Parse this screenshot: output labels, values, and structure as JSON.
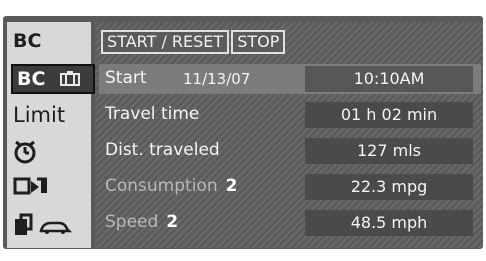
{
  "sidebar": {
    "title": "BC",
    "items": [
      {
        "label": "BC"
      },
      {
        "label": "Limit"
      }
    ],
    "icons": [
      "bc-display-icon",
      "stopwatch-icon",
      "arrow-box-icon",
      "door-car-icon"
    ]
  },
  "toolbar": {
    "start_reset_label": "START / RESET",
    "stop_label": "STOP"
  },
  "rows": [
    {
      "label": "Start",
      "date": "11/13/07",
      "value": "10:10AM"
    },
    {
      "label": "Travel time",
      "value": "01 h 02 min"
    },
    {
      "label": "Dist. traveled",
      "value": "127 mls"
    },
    {
      "label": "Consumption",
      "num": "2",
      "value": "22.3 mpg"
    },
    {
      "label": "Speed",
      "num": "2",
      "value": "48.5 mph"
    }
  ],
  "colors": {
    "screen_bg": "#5a5a5a",
    "sidebar_bg": "#d8d8d8",
    "selected_bg": "#3c3c3c",
    "text_light": "#f5f5f5"
  }
}
